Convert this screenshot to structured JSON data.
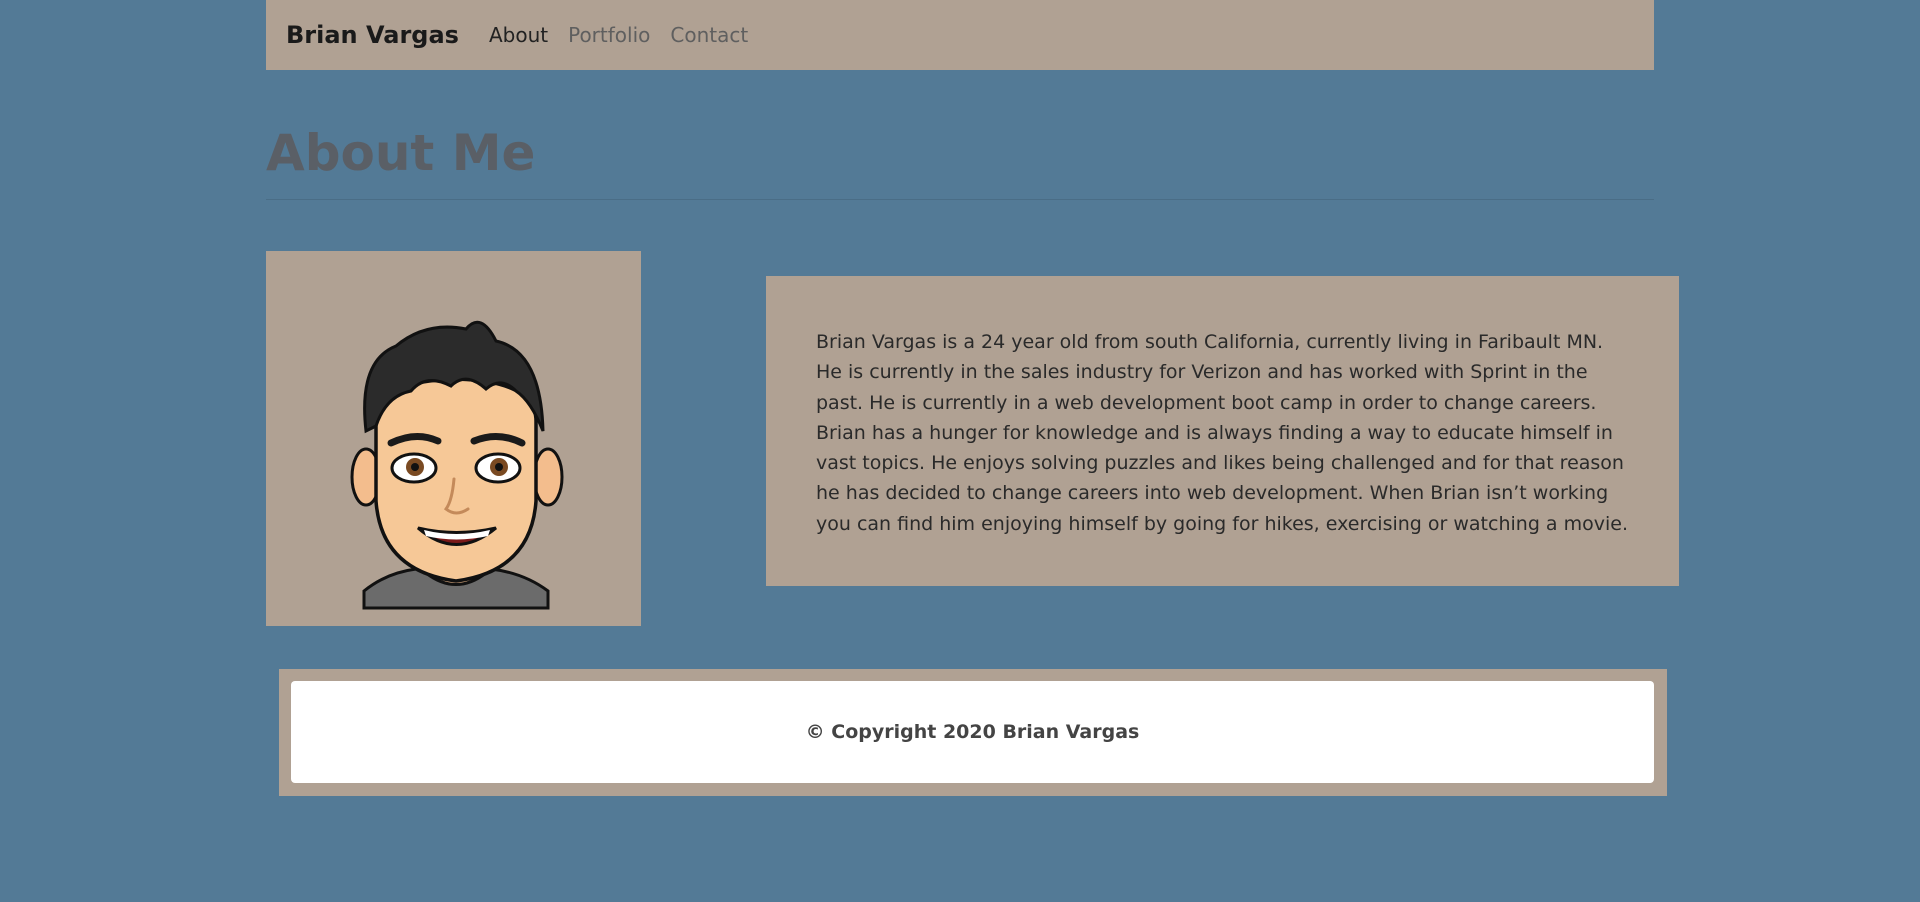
{
  "nav": {
    "brand": "Brian Vargas",
    "links": [
      {
        "label": "About"
      },
      {
        "label": "Portfolio"
      },
      {
        "label": "Contact"
      }
    ]
  },
  "main": {
    "heading": "About Me",
    "avatar_icon": "bitmoji-avatar",
    "bio": "Brian Vargas is a 24 year old from south California, currently living in Faribault MN. He is currently in the sales industry for Verizon and has worked with Sprint in the past. He is currently in a web development boot camp in order to change careers. Brian has a hunger for knowledge and is always finding a way to educate himself in vast topics. He enjoys solving puzzles and likes being challenged and for that reason he has decided to change careers into web development. When Brian isn’t working you can find him enjoying himself by going for hikes, exercising or watching a movie."
  },
  "footer": {
    "copyright": "© Copyright 2020 Brian Vargas"
  },
  "colors": {
    "background": "#537a96",
    "panel": "#b0a193",
    "footer_card": "#ffffff"
  }
}
